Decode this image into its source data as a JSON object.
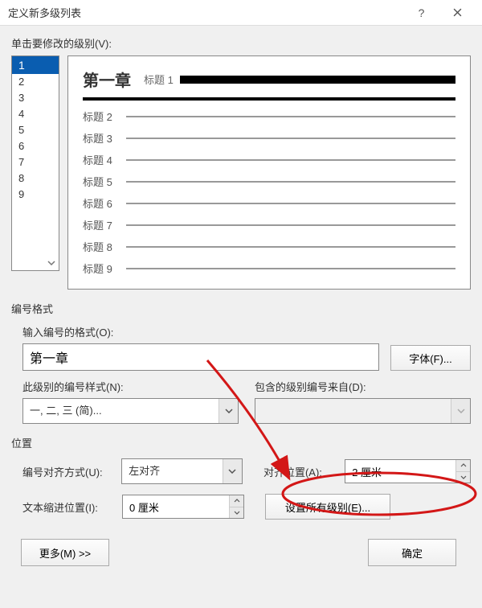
{
  "window": {
    "title": "定义新多级列表"
  },
  "labels": {
    "levels_to_modify": "单击要修改的级别(V):",
    "number_format_group": "编号格式",
    "enter_number_format": "输入编号的格式(O):",
    "font_button": "字体(F)...",
    "number_style": "此级别的编号样式(N):",
    "include_from": "包含的级别编号来自(D):",
    "position_group": "位置",
    "number_alignment": "编号对齐方式(U):",
    "aligned_at": "对齐位置(A):",
    "text_indent_at": "文本缩进位置(I):",
    "set_for_all": "设置所有级别(E)...",
    "more": "更多(M) >>",
    "ok": "确定"
  },
  "levels": [
    "1",
    "2",
    "3",
    "4",
    "5",
    "6",
    "7",
    "8",
    "9"
  ],
  "selected_level": "1",
  "preview": {
    "chapter": "第一章",
    "row_labels": [
      "标题 1",
      "标题 2",
      "标题 3",
      "标题 4",
      "标题 5",
      "标题 6",
      "标题 7",
      "标题 8",
      "标题 9"
    ]
  },
  "values": {
    "number_format": "第一章",
    "number_style": "一, 二, 三 (简)...",
    "include_from": "",
    "alignment": "左对齐",
    "aligned_at": "2 厘米",
    "text_indent_at": "0 厘米"
  }
}
